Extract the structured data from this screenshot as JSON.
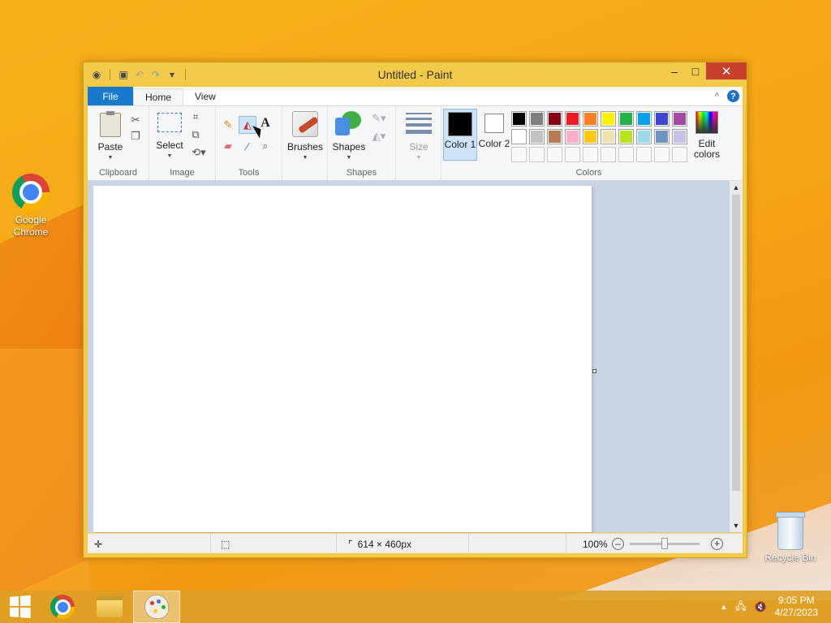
{
  "window": {
    "title": "Untitled - Paint",
    "minimize": "–",
    "maximize": "□",
    "close": "✕"
  },
  "menu": {
    "file": "File",
    "tabs": [
      "Home",
      "View"
    ],
    "collapse": "^",
    "help": "?"
  },
  "ribbon": {
    "clipboard": {
      "paste": "Paste",
      "label": "Clipboard"
    },
    "image": {
      "select": "Select",
      "label": "Image"
    },
    "tools": {
      "label": "Tools",
      "text_tool": "A"
    },
    "brushes": {
      "label": "Brushes"
    },
    "shapes": {
      "shapes": "Shapes",
      "label": "Shapes"
    },
    "size": {
      "label": "Size"
    },
    "colors": {
      "color1": "Color 1",
      "color2": "Color 2",
      "color1_value": "#000000",
      "color2_value": "#ffffff",
      "edit": "Edit colors",
      "label": "Colors",
      "palette": [
        "#000000",
        "#7f7f7f",
        "#880015",
        "#ed1c24",
        "#ff7f27",
        "#fff200",
        "#22b14c",
        "#00a2e8",
        "#3f48cc",
        "#a349a4",
        "#ffffff",
        "#c3c3c3",
        "#b97a57",
        "#ffaec9",
        "#ffc90e",
        "#efe4b0",
        "#b5e61d",
        "#99d9ea",
        "#7092be",
        "#c8bfe7",
        "#ffffff",
        "#ffffff",
        "#ffffff",
        "#ffffff",
        "#ffffff",
        "#ffffff",
        "#ffffff",
        "#ffffff",
        "#ffffff",
        "#ffffff"
      ]
    }
  },
  "status": {
    "image_size": "614 × 460px",
    "zoom": "100%"
  },
  "desktop": {
    "chrome_label": "Google Chrome",
    "recycle_label": "Recycle Bin"
  },
  "taskbar": {
    "time": "9:05 PM",
    "date": "4/27/2023"
  },
  "icons": {
    "app": "paint-app-icon",
    "save": "save-icon",
    "undo": "undo-icon",
    "redo": "redo-icon",
    "cut": "scissors-icon",
    "copy": "copy-icon",
    "crop": "crop-icon",
    "resize": "resize-icon",
    "rotate": "rotate-icon",
    "pencil": "pencil-icon",
    "fill": "fill-bucket-icon",
    "eraser": "eraser-icon",
    "picker": "color-picker-icon",
    "magnifier": "magnifier-icon"
  }
}
